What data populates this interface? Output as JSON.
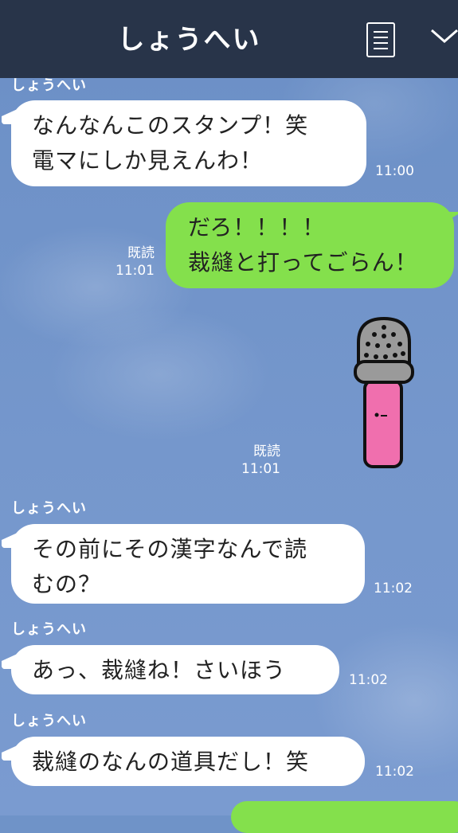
{
  "header": {
    "title": "しょうへい",
    "menu_icon": "menu-icon",
    "collapse_icon": "chevron-down-icon"
  },
  "colors": {
    "header_bg": "#283449",
    "chat_bg": "#6f93c8",
    "out_bubble": "#84e04c",
    "in_bubble": "#ffffff"
  },
  "messages": [
    {
      "sender": "しょうへい",
      "line1": "なんなんこのスタンプ！笑",
      "line2": "電マにしか見えんわ！",
      "time": "11:00"
    },
    {
      "line1": "だろ！！！！",
      "line2": "裁縫と打ってごらん！",
      "read": "既読",
      "time": "11:01"
    },
    {
      "type": "sticker",
      "sticker_icon": "thimble-sticker",
      "read": "既読",
      "time": "11:01"
    },
    {
      "sender": "しょうへい",
      "line1": "その前にその漢字なんで読",
      "line2": "むの？",
      "time": "11:02"
    },
    {
      "sender": "しょうへい",
      "line1": "あっ、裁縫ね！さいほう",
      "time": "11:02"
    },
    {
      "sender": "しょうへい",
      "line1": "裁縫のなんの道具だし！笑",
      "time": "11:02"
    }
  ]
}
